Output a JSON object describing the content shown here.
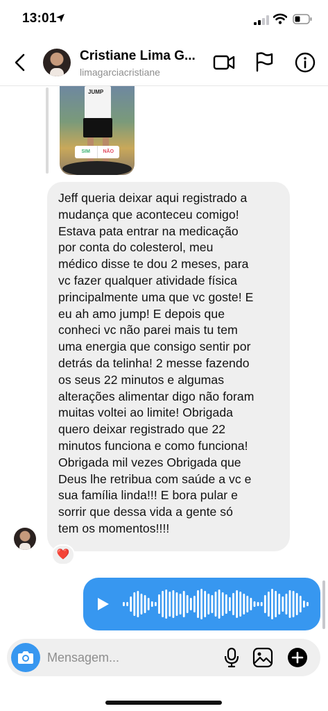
{
  "status_bar": {
    "time": "13:01"
  },
  "header": {
    "contact_name": "Cristiane Lima G...",
    "username": "limagarciacristiane"
  },
  "story_reply": {
    "poll_yes": "SIM",
    "poll_no": "NÃO",
    "shirt_text": "JUMP"
  },
  "message": {
    "text": "Jeff queria deixar aqui registrado a\nmudança que aconteceu comigo!\nEstava pata entrar na medicação\npor conta do colesterol, meu\nmédico disse te dou 2 meses, para\nvc fazer qualquer atividade física\nprincipalmente uma que vc goste! E\neu ah amo jump! E depois que\nconheci vc não parei mais tu tem\numa energia que consigo sentir por\ndetrás da telinha! 2 messe fazendo\nos seus 22 minutos e algumas\nalterações alimentar digo não foram\nmuitas voltei ao limite! Obrigada\nquero deixar registrado que 22\nminutos funciona e como funciona!\nObrigada mil vezes Obrigada que\nDeus lhe retribua com saúde a vc e\nsua família linda!!! E bora pular e\nsorrir que dessa vida a gente só\ntem os momentos!!!!",
    "reaction": "❤️",
    "reaction_color": "#e0245e",
    "bubble_color": "#efefef"
  },
  "voice_message": {
    "bubble_color": "#3797f0",
    "icon": "play-icon"
  },
  "composer": {
    "placeholder": "Mensagem...",
    "icons": [
      "camera-icon",
      "microphone-icon",
      "gallery-icon",
      "plus-icon"
    ]
  },
  "colors": {
    "accent": "#3797f0",
    "secondary_text": "#8e8e8e"
  }
}
